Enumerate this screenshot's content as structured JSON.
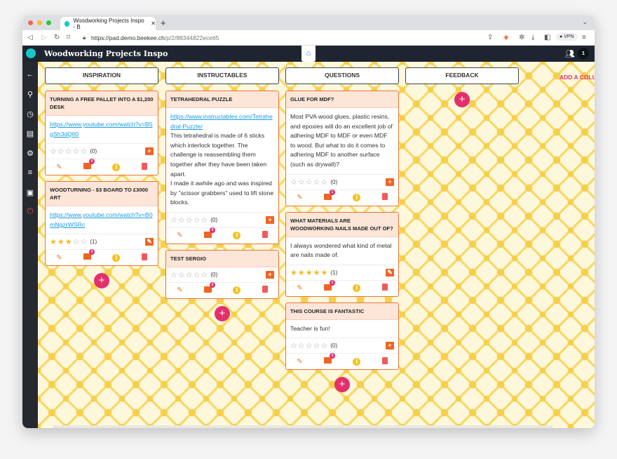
{
  "browser": {
    "tab_title": "Woodworking Projects Inspo - B",
    "url_host": "https://pad.demo.beekee.ch",
    "url_path": "/p/2/88344822ece65",
    "vpn_label": "VPN"
  },
  "app": {
    "title": "Woodworking Projects Inspo",
    "user_count": "1",
    "accent": "#e42f6c",
    "card_border": "#e8773a"
  },
  "sidebar": {
    "items": [
      "back-icon",
      "search-icon",
      "history-icon",
      "chat-icon",
      "settings-icon",
      "sort-icon",
      "slideshow-icon",
      "power-icon"
    ]
  },
  "add_column_label": "ADD A COLUMN",
  "columns": [
    {
      "title": "INSPIRATION",
      "cards": [
        {
          "title": "TURNING A FREE PALLET INTO A $1,200 DESK",
          "link": "https://www.youtube.com/watch?v=B5gSh3dQlI0",
          "text": "",
          "rating": 0,
          "rating_count": "(0)",
          "comments": "0"
        },
        {
          "title": "WOODTURNING - $3 BOARD TO £3000 ART",
          "link": "https://www.youtube.com/watch?v=B0mNgzrWSRc",
          "text": "",
          "rating": 3,
          "rating_count": "(1)",
          "comments": "0",
          "rated": true
        }
      ]
    },
    {
      "title": "INSTRUCTABLES",
      "cards": [
        {
          "title": "TETRAHEDRAL PUZZLE",
          "link": "https://www.instructables.com/Tetrahedral-Puzzle/",
          "text": "This tetrahedral is made of 6 sticks which interlock together. The challenge is reassembling them together after they have been taken apart.\nI made it awhile ago and was inspired by \"scissor grabbers\" used to lift stone blocks.",
          "rating": 0,
          "rating_count": "(0)",
          "comments": "0"
        },
        {
          "title": "TEST SERGIO",
          "link": "",
          "text": "",
          "rating": 0,
          "rating_count": "(0)",
          "comments": "0"
        }
      ]
    },
    {
      "title": "QUESTIONS",
      "cards": [
        {
          "title": "GLUE FOR MDF?",
          "link": "",
          "text": " Most PVA wood glues, plastic resins, and epoxies will do an excellent job of adhering MDF to MDF or even MDF to wood. But what to do it comes to adhering MDF to another surface (such as drywall)?",
          "rating": 0,
          "rating_count": "(0)",
          "comments": "1"
        },
        {
          "title": "WHAT MATERIALS ARE WOODWORKING NAILS MADE OUT OF?",
          "link": "",
          "text": "I always wondered what kind of metal are nails made of.",
          "rating": 5,
          "rating_count": "(1)",
          "comments": "1",
          "rated": true
        },
        {
          "title": "THIS COURSE IS FANTASTIC",
          "link": "",
          "text": "Teacher is fun!",
          "rating": 0,
          "rating_count": "(0)",
          "comments": "0"
        }
      ]
    },
    {
      "title": "FEEDBACK",
      "cards": []
    }
  ]
}
